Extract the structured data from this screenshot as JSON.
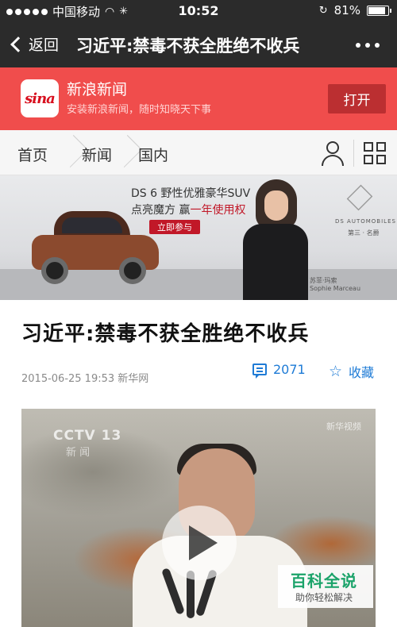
{
  "status_bar": {
    "carrier": "中国移动",
    "time": "10:52",
    "battery_percent": "81%",
    "battery_level": 0.81
  },
  "title_bar": {
    "back_label": "返回",
    "title": "习近平:禁毒不获全胜绝不收兵"
  },
  "app_banner": {
    "name": "新浪新闻",
    "subtitle": "安装新浪新闻，随时知晓天下事",
    "open_label": "打开",
    "logo_text": "sina"
  },
  "breadcrumb": {
    "items": [
      {
        "label": "首页"
      },
      {
        "label": "新闻"
      },
      {
        "label": "国内"
      }
    ]
  },
  "ad": {
    "line1": "DS 6 野性优雅豪华SUV",
    "line2_prefix": "点亮魔方  赢",
    "line2_highlight": "一年使用权",
    "join_label": "立即参与",
    "brand": "DS AUTOMOBILES",
    "credit1": "苏菲·玛索",
    "credit2": "Sophie Marceau",
    "ds_sub": "第三 · 名爵"
  },
  "article": {
    "title": "习近平:禁毒不获全胜绝不收兵",
    "meta": "2015-06-25 19:53 新华网",
    "comment_count": "2071",
    "favorite_label": "收藏"
  },
  "video": {
    "channel": "CCTV 13",
    "channel_sub": "新 闻",
    "watermark": "新华视频"
  },
  "watermark": {
    "title": "百科全说",
    "subtitle": "助你轻松解决"
  },
  "colors": {
    "bar_dark": "#2b2b2b",
    "banner_red": "#f04d4c",
    "open_btn": "#bb2f31",
    "link_blue": "#1e7bd6",
    "baike_green": "#1ba36a"
  }
}
